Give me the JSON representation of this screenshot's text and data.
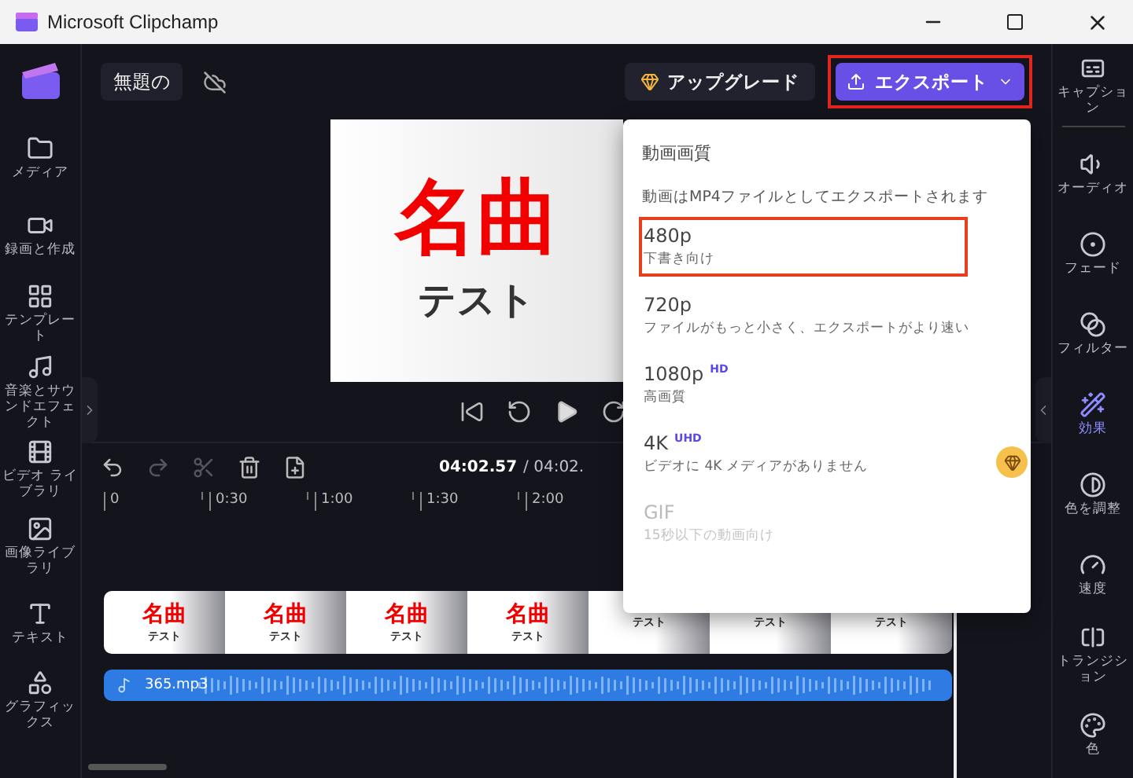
{
  "window": {
    "title": "Microsoft Clipchamp"
  },
  "left_nav": [
    {
      "label": "メディア"
    },
    {
      "label": "録画と作成"
    },
    {
      "label": "テンプレート"
    },
    {
      "label": "音楽とサウンドエフェクト"
    },
    {
      "label": "ビデオ ライブラリ"
    },
    {
      "label": "画像ライブラリ"
    },
    {
      "label": "テキスト"
    },
    {
      "label": "グラフィックス"
    }
  ],
  "top_bar": {
    "project_title": "無題の",
    "upgrade": "アップグレード",
    "export": {
      "label": "エクスポート",
      "highlighted": true
    }
  },
  "preview": {
    "title": "名曲",
    "subtitle": "テスト"
  },
  "timeline": {
    "current_time": "04:02.57",
    "total_time": "/ 04:02.",
    "tools": [
      {
        "disabled": false
      },
      {
        "disabled": true
      },
      {
        "disabled": true
      },
      {
        "disabled": false
      },
      {
        "disabled": false
      }
    ],
    "ruler": [
      "0",
      "0:30",
      "1:00",
      "1:30",
      "2:00"
    ],
    "clips": [
      {
        "title": "名曲",
        "subtitle": "テスト"
      },
      {
        "title": "名曲",
        "subtitle": "テスト"
      },
      {
        "title": "名曲",
        "subtitle": "テスト"
      },
      {
        "title": "名曲",
        "subtitle": "テスト"
      },
      {
        "subtitle": "テスト"
      },
      {
        "subtitle": "テスト"
      },
      {
        "subtitle": "テスト"
      }
    ],
    "audio": {
      "name": "365.mp3"
    }
  },
  "export_menu": {
    "heading": "動画画質",
    "description": "動画はMP4ファイルとしてエクスポートされます",
    "options": [
      {
        "label": "480p",
        "detail": "下書き向け",
        "highlighted": true,
        "disabled": false
      },
      {
        "label": "720p",
        "detail": "ファイルがもっと小さく、エクスポートがより速い",
        "highlighted": false,
        "disabled": false
      },
      {
        "label": "1080p",
        "badge": "HD",
        "detail": "高画質",
        "highlighted": false,
        "disabled": false
      },
      {
        "label": "4K",
        "badge": "UHD",
        "detail": "ビデオに 4K メディアがありません",
        "premium": true,
        "highlighted": false,
        "disabled": false
      },
      {
        "label": "GIF",
        "detail": "15秒以下の動画向け",
        "highlighted": false,
        "disabled": true
      }
    ]
  },
  "right_nav": [
    {
      "label": "キャプション",
      "selected": false
    },
    {
      "label": "オーディオ",
      "selected": false
    },
    {
      "label": "フェード",
      "selected": false
    },
    {
      "label": "フィルター",
      "selected": false
    },
    {
      "label": "効果",
      "selected": true
    },
    {
      "label": "色を調整",
      "selected": false
    },
    {
      "label": "速度",
      "selected": false
    },
    {
      "label": "トランジション",
      "selected": false
    },
    {
      "label": "色",
      "selected": false
    }
  ]
}
